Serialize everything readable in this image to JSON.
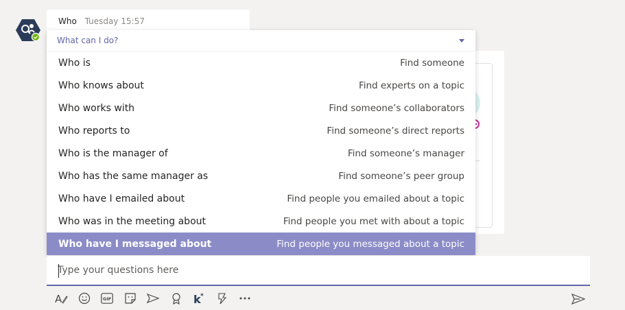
{
  "message": {
    "sender": "Who",
    "timestamp": "Tuesday 15:57",
    "avatar_icon": "bot-people-icon",
    "avatar_color": "#2b3c5a",
    "status_color": "#6bb700"
  },
  "dropdown": {
    "title": "What can I do?",
    "selected_index": 8,
    "items": [
      {
        "command": "Who is",
        "description": "Find someone"
      },
      {
        "command": "Who knows about",
        "description": "Find experts on a topic"
      },
      {
        "command": "Who works with",
        "description": "Find someone’s collaborators"
      },
      {
        "command": "Who reports to",
        "description": "Find someone’s direct reports"
      },
      {
        "command": "Who is the manager of",
        "description": "Find someone’s manager"
      },
      {
        "command": "Who has the same manager as",
        "description": "Find someone’s peer group"
      },
      {
        "command": "Who have I emailed about",
        "description": "Find people you emailed about a topic"
      },
      {
        "command": "Who was in the meeting about",
        "description": "Find people you met with about a topic"
      },
      {
        "command": "Who have I messaged about",
        "description": "Find people you messaged about a topic"
      }
    ]
  },
  "compose": {
    "placeholder": "Type your questions here",
    "value": ""
  },
  "toolbar": {
    "icons": [
      "format-icon",
      "emoji-icon",
      "gif-icon",
      "sticker-icon",
      "meet-icon",
      "praise-icon",
      "kudos-icon",
      "stream-icon",
      "more-options-icon"
    ],
    "send_icon": "send-icon"
  },
  "colors": {
    "accent": "#6264a7",
    "selected_row": "#8b8cc7",
    "background": "#f3f2f1"
  }
}
